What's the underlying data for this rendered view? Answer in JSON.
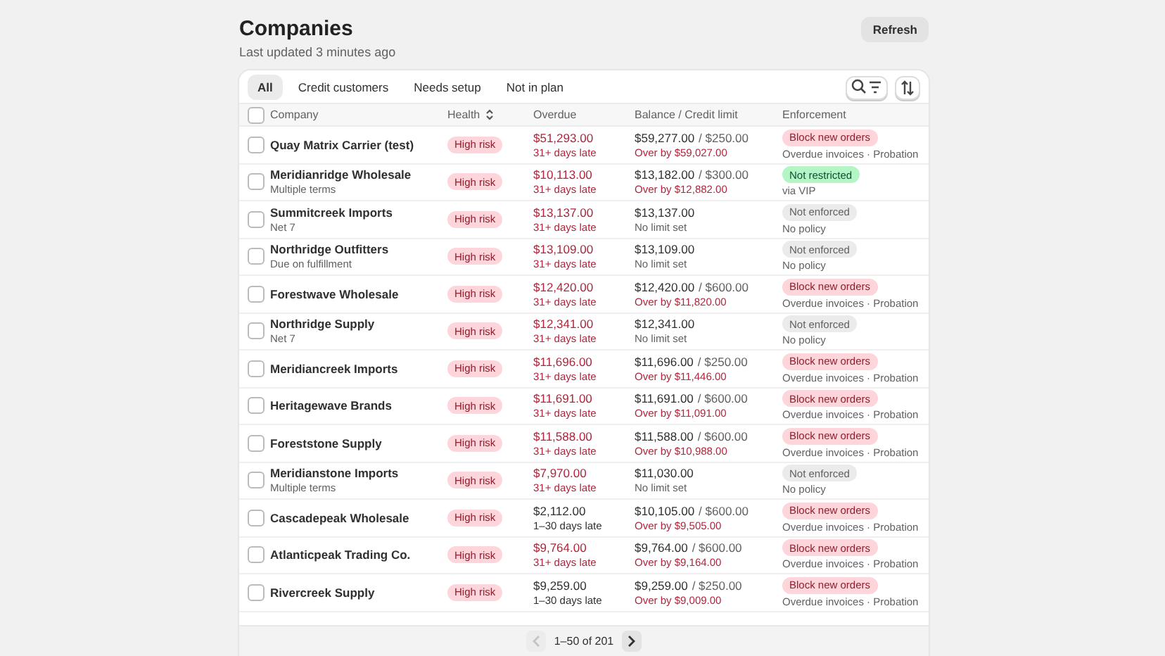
{
  "header": {
    "title": "Companies",
    "subtitle": "Last updated 3 minutes ago",
    "refresh": "Refresh"
  },
  "tabs": [
    {
      "label": "All",
      "selected": true
    },
    {
      "label": "Credit customers",
      "selected": false
    },
    {
      "label": "Needs setup",
      "selected": false
    },
    {
      "label": "Not in plan",
      "selected": false
    }
  ],
  "table": {
    "select_all_checked": false,
    "columns": [
      "Company",
      "Health",
      "Overdue",
      "Balance / Credit limit",
      "Enforcement"
    ],
    "rows": [
      {
        "checked": false,
        "name": "Quay Matrix Carrier (test)",
        "health": "High risk",
        "overdue": {
          "amount": "$51,293.00",
          "late": "31+ days late",
          "kind": "severe"
        },
        "balance": "$59,277.00",
        "limit": "/ $250.00",
        "balance_note": {
          "text": "Over by $59,027.00",
          "kind": "over"
        },
        "enforcement": {
          "label": "Block new orders",
          "note": "Overdue invoices · Probation",
          "kind": "block"
        }
      },
      {
        "checked": false,
        "name": "Meridianridge Wholesale",
        "terms": "Multiple terms",
        "health": "High risk",
        "overdue": {
          "amount": "$10,113.00",
          "late": "31+ days late",
          "kind": "severe"
        },
        "balance": "$13,182.00",
        "limit": "/ $300.00",
        "balance_note": {
          "text": "Over by $12,882.00",
          "kind": "over"
        },
        "enforcement": {
          "label": "Not restricted",
          "note": "via VIP",
          "kind": "allow"
        }
      },
      {
        "checked": false,
        "name": "Summitcreek Imports",
        "terms": "Net 7",
        "health": "High risk",
        "overdue": {
          "amount": "$13,137.00",
          "late": "31+ days late",
          "kind": "severe"
        },
        "balance": "$13,137.00",
        "balance_note": {
          "text": "No limit set",
          "kind": "plain"
        },
        "enforcement": {
          "label": "Not enforced",
          "note": "No policy",
          "kind": "none"
        }
      },
      {
        "checked": false,
        "name": "Northridge Outfitters",
        "terms": "Due on fulfillment",
        "health": "High risk",
        "overdue": {
          "amount": "$13,109.00",
          "late": "31+ days late",
          "kind": "severe"
        },
        "balance": "$13,109.00",
        "balance_note": {
          "text": "No limit set",
          "kind": "plain"
        },
        "enforcement": {
          "label": "Not enforced",
          "note": "No policy",
          "kind": "none"
        }
      },
      {
        "checked": false,
        "name": "Forestwave Wholesale",
        "health": "High risk",
        "overdue": {
          "amount": "$12,420.00",
          "late": "31+ days late",
          "kind": "severe"
        },
        "balance": "$12,420.00",
        "limit": "/ $600.00",
        "balance_note": {
          "text": "Over by $11,820.00",
          "kind": "over"
        },
        "enforcement": {
          "label": "Block new orders",
          "note": "Overdue invoices · Probation",
          "kind": "block"
        }
      },
      {
        "checked": false,
        "name": "Northridge Supply",
        "terms": "Net 7",
        "health": "High risk",
        "overdue": {
          "amount": "$12,341.00",
          "late": "31+ days late",
          "kind": "severe"
        },
        "balance": "$12,341.00",
        "balance_note": {
          "text": "No limit set",
          "kind": "plain"
        },
        "enforcement": {
          "label": "Not enforced",
          "note": "No policy",
          "kind": "none"
        }
      },
      {
        "checked": false,
        "name": "Meridiancreek Imports",
        "health": "High risk",
        "overdue": {
          "amount": "$11,696.00",
          "late": "31+ days late",
          "kind": "severe"
        },
        "balance": "$11,696.00",
        "limit": "/ $250.00",
        "balance_note": {
          "text": "Over by $11,446.00",
          "kind": "over"
        },
        "enforcement": {
          "label": "Block new orders",
          "note": "Overdue invoices · Probation",
          "kind": "block"
        }
      },
      {
        "checked": false,
        "name": "Heritagewave Brands",
        "health": "High risk",
        "overdue": {
          "amount": "$11,691.00",
          "late": "31+ days late",
          "kind": "severe"
        },
        "balance": "$11,691.00",
        "limit": "/ $600.00",
        "balance_note": {
          "text": "Over by $11,091.00",
          "kind": "over"
        },
        "enforcement": {
          "label": "Block new orders",
          "note": "Overdue invoices · Probation",
          "kind": "block"
        }
      },
      {
        "checked": false,
        "name": "Foreststone Supply",
        "health": "High risk",
        "overdue": {
          "amount": "$11,588.00",
          "late": "31+ days late",
          "kind": "severe"
        },
        "balance": "$11,588.00",
        "limit": "/ $600.00",
        "balance_note": {
          "text": "Over by $10,988.00",
          "kind": "over"
        },
        "enforcement": {
          "label": "Block new orders",
          "note": "Overdue invoices · Probation",
          "kind": "block"
        }
      },
      {
        "checked": false,
        "name": "Meridianstone Imports",
        "terms": "Multiple terms",
        "health": "High risk",
        "overdue": {
          "amount": "$7,970.00",
          "late": "31+ days late",
          "kind": "severe"
        },
        "balance": "$11,030.00",
        "balance_note": {
          "text": "No limit set",
          "kind": "plain"
        },
        "enforcement": {
          "label": "Not enforced",
          "note": "No policy",
          "kind": "none"
        }
      },
      {
        "checked": false,
        "name": "Cascadepeak Wholesale",
        "health": "High risk",
        "overdue": {
          "amount": "$2,112.00",
          "late": "1–30 days late",
          "kind": "mild"
        },
        "balance": "$10,105.00",
        "limit": "/ $600.00",
        "balance_note": {
          "text": "Over by $9,505.00",
          "kind": "over"
        },
        "enforcement": {
          "label": "Block new orders",
          "note": "Overdue invoices · Probation",
          "kind": "block"
        }
      },
      {
        "checked": false,
        "name": "Atlanticpeak Trading Co.",
        "health": "High risk",
        "overdue": {
          "amount": "$9,764.00",
          "late": "31+ days late",
          "kind": "severe"
        },
        "balance": "$9,764.00",
        "limit": "/ $600.00",
        "balance_note": {
          "text": "Over by $9,164.00",
          "kind": "over"
        },
        "enforcement": {
          "label": "Block new orders",
          "note": "Overdue invoices · Probation",
          "kind": "block"
        }
      },
      {
        "checked": false,
        "name": "Rivercreek Supply",
        "health": "High risk",
        "overdue": {
          "amount": "$9,259.00",
          "late": "1–30 days late",
          "kind": "mild"
        },
        "balance": "$9,259.00",
        "limit": "/ $250.00",
        "balance_note": {
          "text": "Over by $9,009.00",
          "kind": "over"
        },
        "enforcement": {
          "label": "Block new orders",
          "note": "Overdue invoices · Probation",
          "kind": "block"
        }
      }
    ]
  },
  "pagination": {
    "range": "1–50 of 201",
    "previous_disabled": true,
    "next_disabled": false
  }
}
